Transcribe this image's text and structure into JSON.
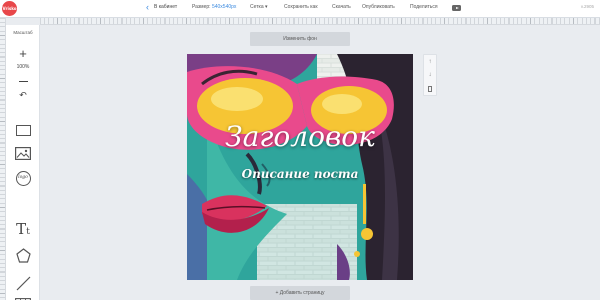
{
  "topbar": {
    "logo_text": "Vrisko",
    "back_label": "В кабинет",
    "size_label": "Размер:",
    "size_value": "540x540px",
    "grid_label": "Сетка ▾",
    "save_as_label": "Сохранить как",
    "download_label": "Скачать",
    "publish_label": "Опубликовать",
    "share_label": "Поделиться",
    "video_icon": "youtube-icon",
    "version": "v.2905"
  },
  "tools": {
    "scale_label": "Масштаб",
    "zoom_in": "+",
    "zoom_value": "100%",
    "undo": "↶",
    "logo_tool_text": "logo",
    "text_tool_big": "T",
    "text_tool_small": "t",
    "items": [
      "rectangle-icon",
      "image-icon",
      "logo-icon",
      "text-icon",
      "polygon-icon",
      "line-icon",
      "table-icon"
    ]
  },
  "canvas": {
    "change_bg_label": "Изменить фон",
    "add_page_label": "+ Добавить страницу",
    "title": "Заголовок",
    "subtitle": "Описание поста"
  },
  "side_tools": {
    "up": "↑",
    "down": "↓"
  },
  "colors": {
    "accent": "#3d8be0",
    "logo": "#e8474a",
    "workspace": "#e9ecf0"
  }
}
